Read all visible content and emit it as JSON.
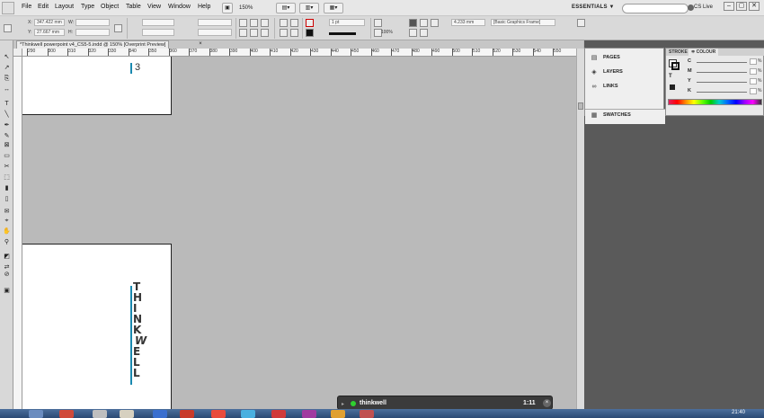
{
  "menubar": {
    "items": [
      "File",
      "Edit",
      "Layout",
      "Type",
      "Object",
      "Table",
      "View",
      "Window",
      "Help"
    ],
    "zoom": "150%",
    "workspace": "ESSENTIALS ▼",
    "cs_live": "CS Live",
    "window_buttons": [
      "–",
      "▢",
      "✕"
    ]
  },
  "control": {
    "x_label": "X:",
    "x_value": "347.422 mm",
    "y_label": "Y:",
    "y_value": "27.667 mm",
    "w_label": "W:",
    "h_label": "H:",
    "stroke_weight": "1 pt",
    "stroke_width": "4.233 mm",
    "opacity": "100%",
    "object_style": "[Basic Graphics Frame]"
  },
  "document": {
    "tab_title": "*Thinkwell powerpoint v4_CS5-5.indd @ 150% [Overprint Preview]",
    "close": "×",
    "ruler_labels": [
      "290",
      "300",
      "310",
      "320",
      "330",
      "340",
      "350",
      "360",
      "370",
      "380",
      "390",
      "400",
      "410",
      "420",
      "430",
      "440",
      "450",
      "460",
      "470",
      "480",
      "490",
      "500",
      "510",
      "520",
      "530",
      "540",
      "550"
    ],
    "page_number": "3",
    "vertical_letters": [
      "T",
      "H",
      "I",
      "N",
      "K",
      "W",
      "E",
      "L",
      "L"
    ]
  },
  "panels": {
    "dock": [
      {
        "label": "PAGES",
        "icon": "pages-icon",
        "glyph": "▤"
      },
      {
        "label": "LAYERS",
        "icon": "layers-icon",
        "glyph": "◈"
      },
      {
        "label": "LINKS",
        "icon": "links-icon",
        "glyph": "∞"
      }
    ],
    "swatches": {
      "label": "SWATCHES",
      "icon": "swatches-icon",
      "glyph": "▦"
    },
    "color_tabs": [
      "STROKE",
      "≑ COLOUR"
    ],
    "sliders": [
      {
        "label": "C",
        "pct": "%"
      },
      {
        "label": "M",
        "pct": "%"
      },
      {
        "label": "Y",
        "pct": "%"
      },
      {
        "label": "K",
        "pct": "%"
      }
    ]
  },
  "video": {
    "title": "thinkwell",
    "time": "1:11",
    "close": "×"
  },
  "taskbar": {
    "time": "21:40"
  },
  "tools": [
    {
      "name": "selection-tool",
      "glyph": "↖"
    },
    {
      "name": "direct-selection-tool",
      "glyph": "↗"
    },
    {
      "name": "page-tool",
      "glyph": "⎘"
    },
    {
      "name": "gap-tool",
      "glyph": "↔"
    },
    {
      "name": "type-tool",
      "glyph": "T"
    },
    {
      "name": "line-tool",
      "glyph": "╲"
    },
    {
      "name": "pen-tool",
      "glyph": "✒"
    },
    {
      "name": "pencil-tool",
      "glyph": "✎"
    },
    {
      "name": "rectangle-frame-tool",
      "glyph": "⊠"
    },
    {
      "name": "rectangle-tool",
      "glyph": "▭"
    },
    {
      "name": "scissors-tool",
      "glyph": "✂"
    },
    {
      "name": "free-transform-tool",
      "glyph": "⬚"
    },
    {
      "name": "gradient-tool",
      "glyph": "▮"
    },
    {
      "name": "gradient-feather-tool",
      "glyph": "▯"
    },
    {
      "name": "note-tool",
      "glyph": "✉"
    },
    {
      "name": "eyedropper-tool",
      "glyph": "⌖"
    },
    {
      "name": "hand-tool",
      "glyph": "✋"
    },
    {
      "name": "zoom-tool",
      "glyph": "⚲"
    },
    {
      "name": "fill-stroke-swatch",
      "glyph": "◩"
    },
    {
      "name": "swap-fill-stroke",
      "glyph": "⇄"
    },
    {
      "name": "apply-none",
      "glyph": "⊘"
    },
    {
      "name": "view-mode",
      "glyph": "▣"
    }
  ],
  "colors": {
    "accent": "#1a89b0",
    "video_dot": "#2fd12f",
    "taskbar": "#2b4a74"
  }
}
